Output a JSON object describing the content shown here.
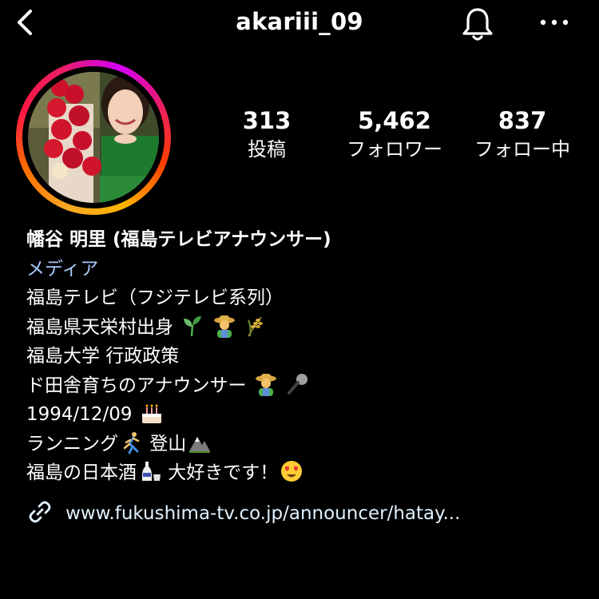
{
  "header": {
    "username": "akariii_09",
    "back_icon": "chevron-left-icon",
    "bell_icon": "bell-icon",
    "more_icon": "more-horizontal-icon"
  },
  "profile": {
    "avatar_icon": "profile-photo"
  },
  "stats": {
    "posts": {
      "value": "313",
      "label": "投稿"
    },
    "followers": {
      "value": "5,462",
      "label": "フォロワー"
    },
    "following": {
      "value": "837",
      "label": "フォロー中"
    }
  },
  "bio": {
    "name": "幡谷 明里 (福島テレビアナウンサー)",
    "category": "メディア",
    "line1": "福島テレビ（フジテレビ系列）",
    "line2": "福島県天栄村出身",
    "line3": "福島大学 行政政策",
    "line4": "ド田舎育ちのアナウンサー",
    "line5": "1994/12/09",
    "line6_a": "ランニング",
    "line6_b": " 登山",
    "line7_a": "福島の日本酒",
    "line7_b": " 大好きです！",
    "emoji": {
      "seedling": "seedling-emoji",
      "farmer": "farmer-emoji",
      "rice": "rice-ear-emoji",
      "mic": "microphone-emoji",
      "cake": "birthday-cake-emoji",
      "runner": "runner-emoji",
      "mountain": "mountain-emoji",
      "sake": "sake-emoji",
      "heart_eyes": "heart-eyes-emoji"
    }
  },
  "link": {
    "icon": "link-icon",
    "text": "www.fukushima-tv.co.jp/announcer/hatay..."
  },
  "colors": {
    "background": "#000000",
    "text": "#ffffff",
    "category": "#a8c7fa",
    "link": "#e0f1ff"
  }
}
